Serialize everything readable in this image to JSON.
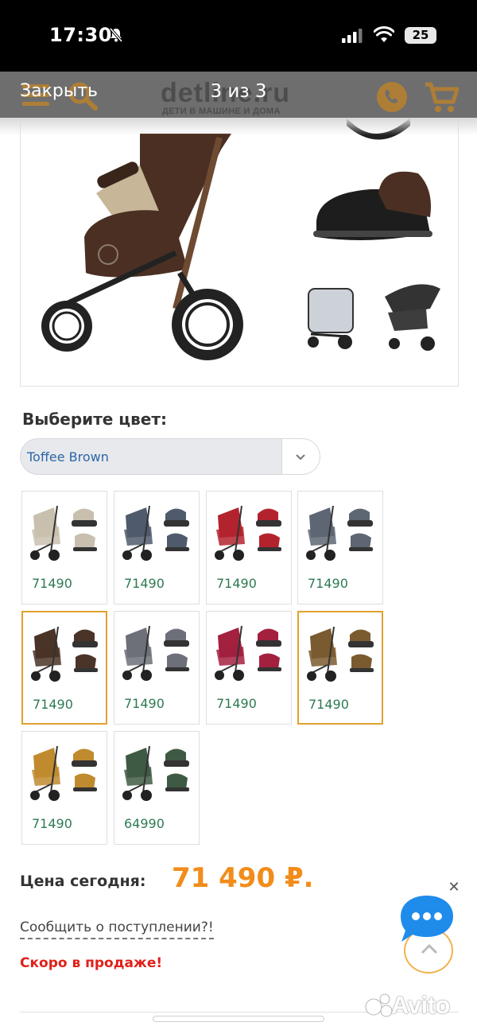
{
  "status_bar": {
    "time": "17:30",
    "battery": "25"
  },
  "viewer": {
    "close_label": "Закрыть",
    "counter": "3 из 3"
  },
  "site": {
    "logo": "detline.ru",
    "tagline": "ДЕТИ В МАШИНЕ И ДОМА"
  },
  "color_select": {
    "label": "Выберите цвет:",
    "value": "Toffee Brown"
  },
  "swatches": [
    {
      "price": "71490",
      "color": "#c9bfae",
      "selected": false
    },
    {
      "price": "71490",
      "color": "#4f5a6c",
      "selected": false
    },
    {
      "price": "71490",
      "color": "#b3232e",
      "selected": false
    },
    {
      "price": "71490",
      "color": "#5d6672",
      "selected": false
    },
    {
      "price": "71490",
      "color": "#4a3427",
      "selected": true
    },
    {
      "price": "71490",
      "color": "#6d7078",
      "selected": false
    },
    {
      "price": "71490",
      "color": "#a3203f",
      "selected": false
    },
    {
      "price": "71490",
      "color": "#7a5a2f",
      "selected": true
    },
    {
      "price": "71490",
      "color": "#c08a2e",
      "selected": false
    },
    {
      "price": "64990",
      "color": "#3f5a44",
      "selected": false
    }
  ],
  "price": {
    "label": "Цена сегодня:",
    "value": "71 490 ₽."
  },
  "notify_link": "Сообщить о поступлении?!",
  "availability": "Скоро в продаже!",
  "colors": {
    "accent": "#f28c1a",
    "price_green": "#2d7a52",
    "selected_border": "#e0a12f",
    "soon_red": "#e0201a"
  },
  "watermark": "Avito"
}
